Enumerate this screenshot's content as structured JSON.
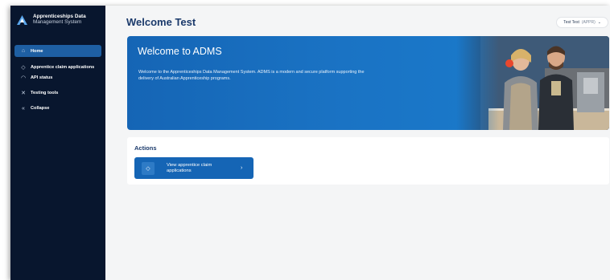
{
  "sidebar": {
    "brand_line1": "Apprenticeships Data",
    "brand_line2": "Management System",
    "items": [
      {
        "label": "Home",
        "icon": "home-icon"
      },
      {
        "label": "Apprentice claim applications",
        "icon": "tag-icon"
      },
      {
        "label": "API status",
        "icon": "pulse-icon"
      },
      {
        "label": "Testing tools",
        "icon": "tools-icon"
      },
      {
        "label": "Collapse",
        "icon": "collapse-icon"
      }
    ]
  },
  "header": {
    "title": "Welcome Test",
    "user_name": "Test Test",
    "user_role": "(APPR)"
  },
  "hero": {
    "title": "Welcome to ADMS",
    "description": "Welcome to the Apprenticeships Data Management System. ADMS is a modern and secure platform supporting the delivery of Australian Apprenticeship programs."
  },
  "actions": {
    "title": "Actions",
    "button_label": "View apprentice claim applications"
  },
  "colors": {
    "sidebar_bg": "#08162e",
    "accent": "#1565b5",
    "title": "#1b3a6b"
  }
}
